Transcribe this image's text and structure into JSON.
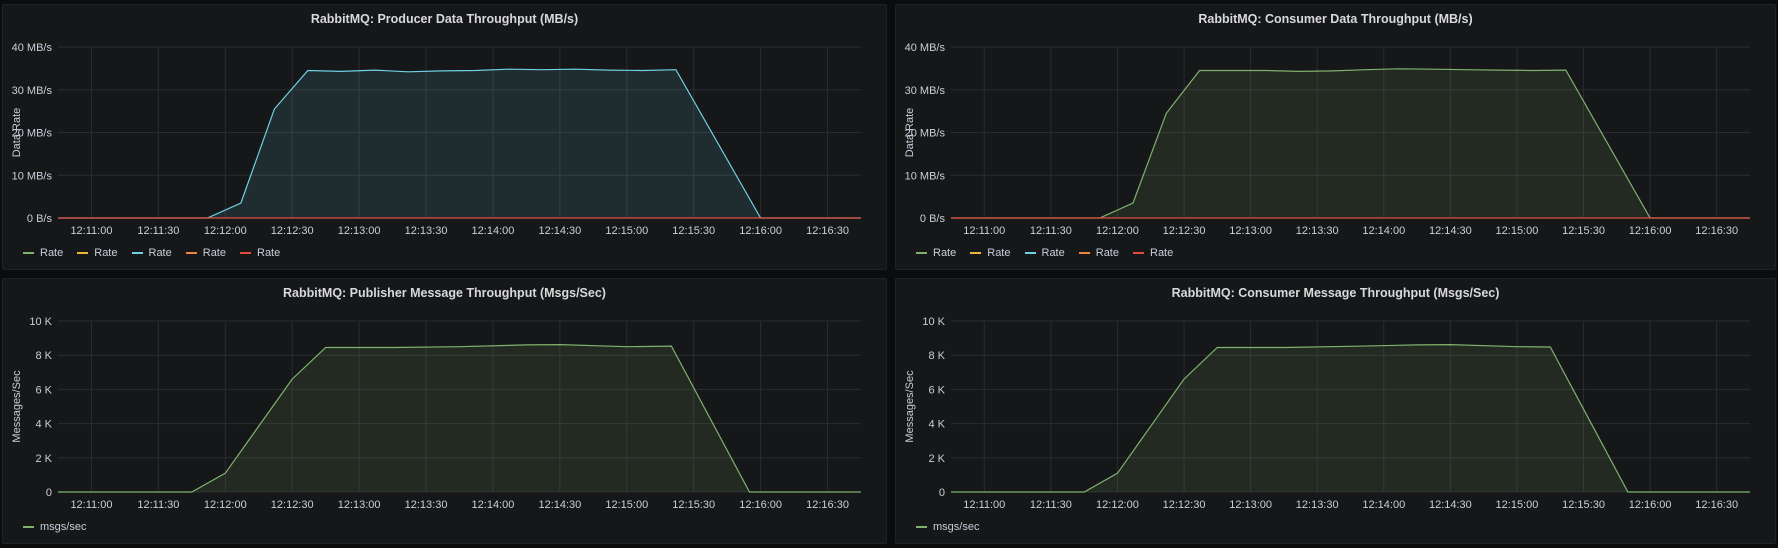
{
  "panels": [
    {
      "title": "RabbitMQ: Producer Data Throughput (MB/s)",
      "legend": [
        "Rate",
        "Rate",
        "Rate",
        "Rate",
        "Rate"
      ],
      "legend_colors": [
        "#7eb26d",
        "#eab839",
        "#6ed0e0",
        "#ef843c",
        "#e24d42"
      ]
    },
    {
      "title": "RabbitMQ: Consumer Data Throughput (MB/s)",
      "legend": [
        "Rate",
        "Rate",
        "Rate",
        "Rate",
        "Rate"
      ],
      "legend_colors": [
        "#7eb26d",
        "#eab839",
        "#6ed0e0",
        "#ef843c",
        "#e24d42"
      ]
    },
    {
      "title": "RabbitMQ: Publisher Message Throughput (Msgs/Sec)",
      "legend": [
        "msgs/sec"
      ],
      "legend_colors": [
        "#7eb26d"
      ]
    },
    {
      "title": "RabbitMQ: Consumer Message Throughput (Msgs/Sec)",
      "legend": [
        "msgs/sec"
      ],
      "legend_colors": [
        "#7eb26d"
      ]
    }
  ],
  "chart_data": [
    {
      "type": "area",
      "title": "RabbitMQ: Producer Data Throughput (MB/s)",
      "ylabel": "Data Rate",
      "ylim": [
        0,
        40
      ],
      "yticks": [
        0,
        10,
        20,
        30,
        40
      ],
      "ytick_labels": [
        "0 B/s",
        "10 MB/s",
        "20 MB/s",
        "30 MB/s",
        "40 MB/s"
      ],
      "xlim": [
        "12:10:45",
        "12:16:45"
      ],
      "xticks": [
        "12:11:00",
        "12:11:30",
        "12:12:00",
        "12:12:30",
        "12:13:00",
        "12:13:30",
        "12:14:00",
        "12:14:30",
        "12:15:00",
        "12:15:30",
        "12:16:00",
        "12:16:30"
      ],
      "series": [
        {
          "name": "Rate",
          "color": "#6ed0e0",
          "x": [
            "12:10:45",
            "12:11:45",
            "12:11:52",
            "12:12:07",
            "12:12:22",
            "12:12:37",
            "12:12:52",
            "12:13:07",
            "12:13:22",
            "12:13:37",
            "12:13:52",
            "12:14:07",
            "12:14:22",
            "12:14:37",
            "12:14:52",
            "12:15:07",
            "12:15:22",
            "12:16:00",
            "12:16:45"
          ],
          "values": [
            0,
            0,
            0,
            3.5,
            25.5,
            34.5,
            34.3,
            34.6,
            34.2,
            34.4,
            34.5,
            34.8,
            34.7,
            34.8,
            34.6,
            34.5,
            34.7,
            0,
            0
          ]
        },
        {
          "name": "Rate",
          "color": "#e24d42",
          "x": [
            "12:10:45",
            "12:16:45"
          ],
          "values": [
            0,
            0
          ]
        }
      ]
    },
    {
      "type": "area",
      "title": "RabbitMQ: Consumer Data Throughput (MB/s)",
      "ylabel": "Data Rate",
      "ylim": [
        0,
        40
      ],
      "yticks": [
        0,
        10,
        20,
        30,
        40
      ],
      "ytick_labels": [
        "0 B/s",
        "10 MB/s",
        "20 MB/s",
        "30 MB/s",
        "40 MB/s"
      ],
      "xlim": [
        "12:10:45",
        "12:16:45"
      ],
      "xticks": [
        "12:11:00",
        "12:11:30",
        "12:12:00",
        "12:12:30",
        "12:13:00",
        "12:13:30",
        "12:14:00",
        "12:14:30",
        "12:15:00",
        "12:15:30",
        "12:16:00",
        "12:16:30"
      ],
      "series": [
        {
          "name": "Rate",
          "color": "#7eb26d",
          "x": [
            "12:10:45",
            "12:11:45",
            "12:11:52",
            "12:12:07",
            "12:12:22",
            "12:12:37",
            "12:12:52",
            "12:13:07",
            "12:13:22",
            "12:13:37",
            "12:13:52",
            "12:14:07",
            "12:14:22",
            "12:14:37",
            "12:14:52",
            "12:15:07",
            "12:15:22",
            "12:16:00",
            "12:16:45"
          ],
          "values": [
            0,
            0,
            0,
            3.5,
            24.5,
            34.5,
            34.5,
            34.5,
            34.3,
            34.4,
            34.7,
            34.9,
            34.8,
            34.7,
            34.6,
            34.5,
            34.6,
            0,
            0
          ]
        },
        {
          "name": "Rate",
          "color": "#e24d42",
          "x": [
            "12:10:45",
            "12:16:45"
          ],
          "values": [
            0,
            0
          ]
        }
      ]
    },
    {
      "type": "area",
      "title": "RabbitMQ: Publisher Message Throughput (Msgs/Sec)",
      "ylabel": "Messages/Sec",
      "ylim": [
        0,
        10000
      ],
      "yticks": [
        0,
        2000,
        4000,
        6000,
        8000,
        10000
      ],
      "ytick_labels": [
        "0",
        "2 K",
        "4 K",
        "6 K",
        "8 K",
        "10 K"
      ],
      "xlim": [
        "12:10:45",
        "12:16:45"
      ],
      "xticks": [
        "12:11:00",
        "12:11:30",
        "12:12:00",
        "12:12:30",
        "12:13:00",
        "12:13:30",
        "12:14:00",
        "12:14:30",
        "12:15:00",
        "12:15:30",
        "12:16:00",
        "12:16:30"
      ],
      "series": [
        {
          "name": "msgs/sec",
          "color": "#7eb26d",
          "x": [
            "12:10:45",
            "12:11:45",
            "12:12:00",
            "12:12:30",
            "12:12:45",
            "12:13:15",
            "12:13:45",
            "12:14:15",
            "12:14:30",
            "12:15:00",
            "12:15:20",
            "12:15:55",
            "12:16:45"
          ],
          "values": [
            0,
            0,
            1100,
            6600,
            8450,
            8450,
            8500,
            8600,
            8620,
            8500,
            8530,
            0,
            0
          ]
        }
      ]
    },
    {
      "type": "area",
      "title": "RabbitMQ: Consumer Message Throughput (Msgs/Sec)",
      "ylabel": "Messages/Sec",
      "ylim": [
        0,
        10000
      ],
      "yticks": [
        0,
        2000,
        4000,
        6000,
        8000,
        10000
      ],
      "ytick_labels": [
        "0",
        "2 K",
        "4 K",
        "6 K",
        "8 K",
        "10 K"
      ],
      "xlim": [
        "12:10:45",
        "12:16:45"
      ],
      "xticks": [
        "12:11:00",
        "12:11:30",
        "12:12:00",
        "12:12:30",
        "12:13:00",
        "12:13:30",
        "12:14:00",
        "12:14:30",
        "12:15:00",
        "12:15:30",
        "12:16:00",
        "12:16:30"
      ],
      "series": [
        {
          "name": "msgs/sec",
          "color": "#7eb26d",
          "x": [
            "12:10:45",
            "12:11:45",
            "12:12:00",
            "12:12:30",
            "12:12:45",
            "12:13:15",
            "12:13:45",
            "12:14:15",
            "12:14:30",
            "12:15:00",
            "12:15:15",
            "12:15:50",
            "12:16:45"
          ],
          "values": [
            0,
            0,
            1100,
            6600,
            8450,
            8450,
            8520,
            8600,
            8620,
            8500,
            8480,
            0,
            0
          ]
        }
      ]
    }
  ]
}
